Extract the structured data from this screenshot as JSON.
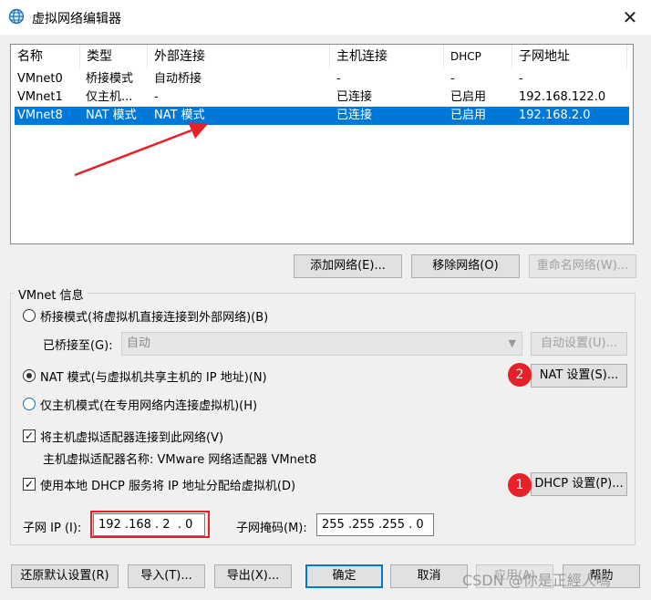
{
  "window": {
    "title": "虚拟网络编辑器",
    "close": "✕"
  },
  "table": {
    "headers": [
      "名称",
      "类型",
      "外部连接",
      "主机连接",
      "DHCP",
      "子网地址"
    ],
    "rows": [
      [
        "VMnet0",
        "桥接模式",
        "自动桥接",
        "-",
        "-",
        "-"
      ],
      [
        "VMnet1",
        "仅主机...",
        "-",
        "已连接",
        "已启用",
        "192.168.122.0"
      ],
      [
        "VMnet8",
        "NAT 模式",
        "NAT 模式",
        "已连接",
        "已启用",
        "192.168.2.0"
      ]
    ],
    "selected_row": 2
  },
  "table_buttons": {
    "add": "添加网络(E)...",
    "remove": "移除网络(O)",
    "rename": "重命名网络(W)..."
  },
  "vmnet_info": {
    "group_label": "VMnet 信息",
    "bridged_radio": "桥接模式(将虚拟机直接连接到外部网络)(B)",
    "bridged_to_label": "已桥接至(G):",
    "bridged_to_value": "自动",
    "auto_settings": "自动设置(U)...",
    "nat_radio": "NAT 模式(与虚拟机共享主机的 IP 地址)(N)",
    "nat_settings": "NAT 设置(S)...",
    "hostonly_radio": "仅主机模式(在专用网络内连接虚拟机)(H)",
    "connect_adapter_check": "将主机虚拟适配器连接到此网络(V)",
    "adapter_name_line": "主机虚拟适配器名称: VMware 网络适配器 VMnet8",
    "dhcp_check": "使用本地 DHCP 服务将 IP 地址分配给虚拟机(D)",
    "dhcp_settings": "DHCP 设置(P)...",
    "subnet_ip_label": "子网 IP (I):",
    "subnet_ip_value": "192 .168 . 2  . 0",
    "subnet_mask_label": "子网掩码(M):",
    "subnet_mask_value": "255 .255 .255 . 0",
    "selected_mode": "nat",
    "connect_adapter_checked": true,
    "dhcp_checked": true
  },
  "annotations": {
    "badge1": "1",
    "badge2": "2",
    "accent": "#e8202a"
  },
  "bottom_buttons": {
    "restore": "还原默认设置(R)",
    "import": "导入(T)...",
    "export": "导出(X)...",
    "ok": "确定",
    "cancel": "取消",
    "apply": "应用(A)",
    "help": "帮助"
  },
  "watermark": "CSDN @你是正經人嗎",
  "colors": {
    "selection": "#0078d7",
    "annotation_red": "#e8202a"
  }
}
